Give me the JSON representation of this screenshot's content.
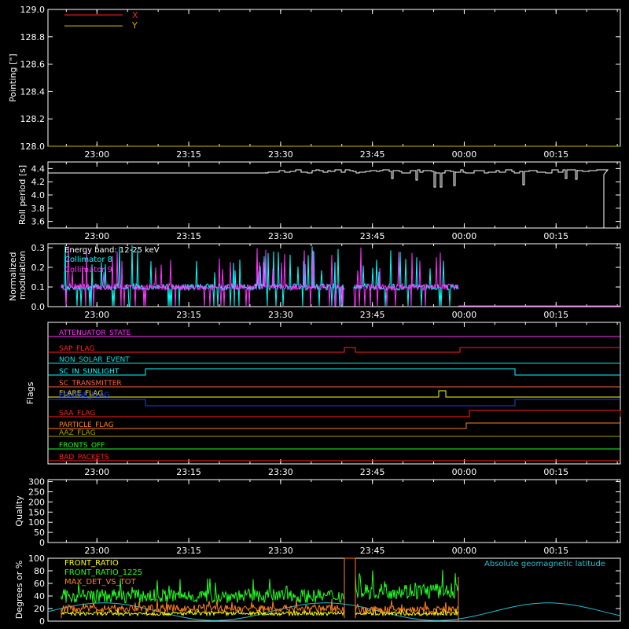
{
  "chart_data": [
    {
      "type": "line",
      "ylabel": "Pointing [\"]",
      "y_ticks": [
        "128.0",
        "128.2",
        "128.4",
        "128.6",
        "128.8",
        "129.0"
      ],
      "ylim": [
        128.0,
        129.0
      ],
      "x_ticks": [
        "23:00",
        "23:15",
        "23:30",
        "23:45",
        "00:00",
        "00:15"
      ],
      "legend": [
        {
          "name": "X",
          "color": "#ff2020"
        },
        {
          "name": "Y",
          "color": "#c8b400"
        }
      ],
      "grid": false
    },
    {
      "type": "line",
      "ylabel": "Roll period [s]",
      "y_ticks": [
        "3.6",
        "3.8",
        "4.0",
        "4.2",
        "4.4"
      ],
      "ylim": [
        3.5,
        4.5
      ],
      "x_ticks": [
        "23:00",
        "23:15",
        "23:30",
        "23:45",
        "00:00",
        "00:15"
      ],
      "series": [
        {
          "color": "#ffffff",
          "x": [
            "22:52",
            "23:26",
            "23:55",
            "00:24",
            "00:25"
          ],
          "values": [
            4.35,
            4.37,
            4.36,
            4.35,
            3.5
          ]
        }
      ],
      "grid": false
    },
    {
      "type": "line",
      "ylabel": "Normalized modulation",
      "y_ticks": [
        "0.0",
        "0.1",
        "0.2",
        "0.3"
      ],
      "ylim": [
        0.0,
        0.32
      ],
      "x_ticks": [
        "23:00",
        "23:15",
        "23:30",
        "23:45",
        "00:00",
        "00:15"
      ],
      "annotation": "Energy band: 12-25 keV",
      "legend": [
        {
          "name": "Collimator 8",
          "color": "#00ffff"
        },
        {
          "name": "Collimator 9",
          "color": "#ff33ff"
        }
      ],
      "grid": false
    },
    {
      "type": "line",
      "ylabel": "Flags",
      "x_ticks": [
        "23:00",
        "23:15",
        "23:30",
        "23:45",
        "00:00",
        "00:15"
      ],
      "flags": [
        {
          "name": "ATTENUATOR_STATE",
          "color": "#ff33ff"
        },
        {
          "name": "SAP_FLAG",
          "color": "#ff2020"
        },
        {
          "name": "NON_SOLAR_EVENT",
          "color": "#00e0e0"
        },
        {
          "name": "SC_IN_SUNLIGHT",
          "color": "#00ffff"
        },
        {
          "name": "SC_TRANSMITTER",
          "color": "#ff6040"
        },
        {
          "name": "FLARE_FLAG",
          "color": "#ffff00"
        },
        {
          "name": "ECLIPSE_FLAG",
          "color": "#2040ff"
        },
        {
          "name": "SAA_FLAG",
          "color": "#ff2020"
        },
        {
          "name": "PARTICLE_FLAG",
          "color": "#ff8020"
        },
        {
          "name": "AAZ_FLAG",
          "color": "#a0a000"
        },
        {
          "name": "FRONTS_OFF",
          "color": "#20ff20"
        },
        {
          "name": "BAD_PACKETS",
          "color": "#ff2020"
        }
      ],
      "grid": false
    },
    {
      "type": "line",
      "ylabel": "Quality",
      "y_ticks": [
        "0",
        "50",
        "100",
        "150",
        "200",
        "250",
        "300"
      ],
      "ylim": [
        0,
        310
      ],
      "x_ticks": [
        "23:00",
        "23:15",
        "23:30",
        "23:45",
        "00:00",
        "00:15"
      ],
      "grid": false
    },
    {
      "type": "line",
      "ylabel": "Degrees or %",
      "y_ticks": [
        "0",
        "20",
        "40",
        "60",
        "80",
        "100"
      ],
      "ylim": [
        0,
        100
      ],
      "legend": [
        {
          "name": "FRONT_RATIO",
          "color": "#ffff00"
        },
        {
          "name": "FRONT_RATIO_1225",
          "color": "#20ff20"
        },
        {
          "name": "MAX_DET_VS_TOT",
          "color": "#ff8020"
        }
      ],
      "annotation": "Absolute geomagnetic latitude",
      "annotation_color": "#20c0d0",
      "grid": false
    }
  ]
}
